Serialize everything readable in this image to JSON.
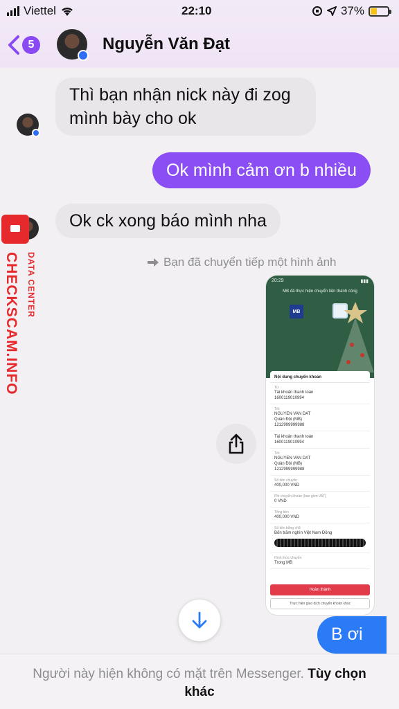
{
  "status_bar": {
    "carrier": "Viettel",
    "time": "22:10",
    "battery": "37%"
  },
  "header": {
    "back_count": "5",
    "contact_name": "Nguyễn Văn Đạt"
  },
  "messages": [
    {
      "from": "them",
      "text": "Thì bạn nhận nick này đi zog mình bày cho ok"
    },
    {
      "from": "me",
      "text": "Ok mình cảm ơn b nhiều"
    },
    {
      "from": "them",
      "text": "Ok ck xong báo mình nha"
    },
    {
      "from": "me",
      "text": "B ơi"
    }
  ],
  "forward_note": "Bạn đã chuyển tiếp một hình ảnh",
  "forwarded_image": {
    "status_time": "20:29",
    "title": "MB đã thực hiện chuyển tiền thành công",
    "bank_logo": "MB",
    "section_title": "Nội dung chuyển khoản",
    "rows": [
      {
        "label": "Từ",
        "value": "Tài khoản thanh toán\n1600119010994"
      },
      {
        "label": "Tới",
        "value": "NGUYEN VAN DAT\nQuân Đội (MB)\n1212999999988"
      },
      {
        "label": "",
        "value": "Tài khoản thanh toán\n1600119010994"
      },
      {
        "label": "Tới",
        "value": "NGUYEN VAN DAT\nQuân Đội (MB)\n1212999999988"
      },
      {
        "label": "Số tiền chuyển",
        "value": "400,000 VND"
      },
      {
        "label": "Phí chuyển khoản (bao gồm VAT)",
        "value": "0 VND"
      },
      {
        "label": "Tổng tiền",
        "value": "400,000 VND"
      },
      {
        "label": "Số tiền bằng chữ",
        "value": "Bốn trăm nghìn Việt Nam Đồng"
      }
    ],
    "method_label": "Hình thức chuyển",
    "method_value": "Trong MB",
    "primary_button": "Hoàn thành",
    "secondary_button": "Thực hiện giao dịch chuyển khoản khác"
  },
  "watermark": {
    "big": "CHECKSCAM.INFO",
    "small": "DATA CENTER"
  },
  "footer": {
    "text": "Người này hiện không có mặt trên Messenger.",
    "link": "Tùy chọn khác"
  },
  "colors": {
    "accent": "#8b4df4",
    "sent_blue": "#2b7bf6",
    "received": "#e9e6ea",
    "watermark": "#e5292d"
  }
}
